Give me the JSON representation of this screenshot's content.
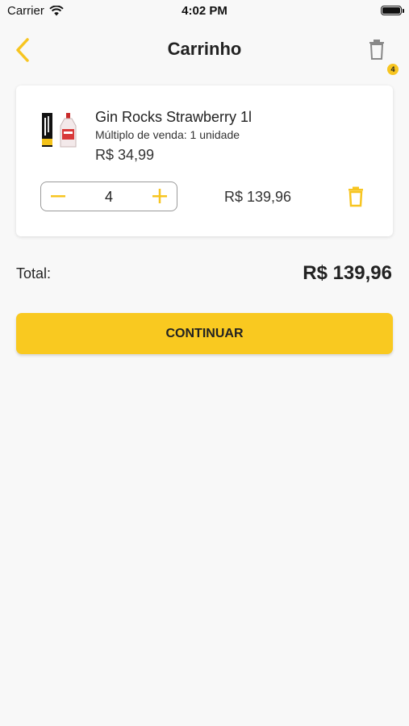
{
  "status_bar": {
    "carrier": "Carrier",
    "time": "4:02 PM"
  },
  "header": {
    "title": "Carrinho",
    "cart_badge_count": "4"
  },
  "cart_item": {
    "name": "Gin Rocks Strawberry 1l",
    "multiple": "Múltiplo de venda: 1 unidade",
    "unit_price": "R$ 34,99",
    "quantity": "4",
    "line_total": "R$ 139,96"
  },
  "summary": {
    "total_label": "Total:",
    "total_value": "R$ 139,96"
  },
  "actions": {
    "continue_label": "CONTINUAR"
  },
  "colors": {
    "accent": "#f9c920",
    "background": "#f8f8f8",
    "text": "#222222"
  },
  "icons": {
    "back": "chevron-left-icon",
    "trash": "trash-icon",
    "minus": "minus-icon",
    "plus": "plus-icon"
  }
}
